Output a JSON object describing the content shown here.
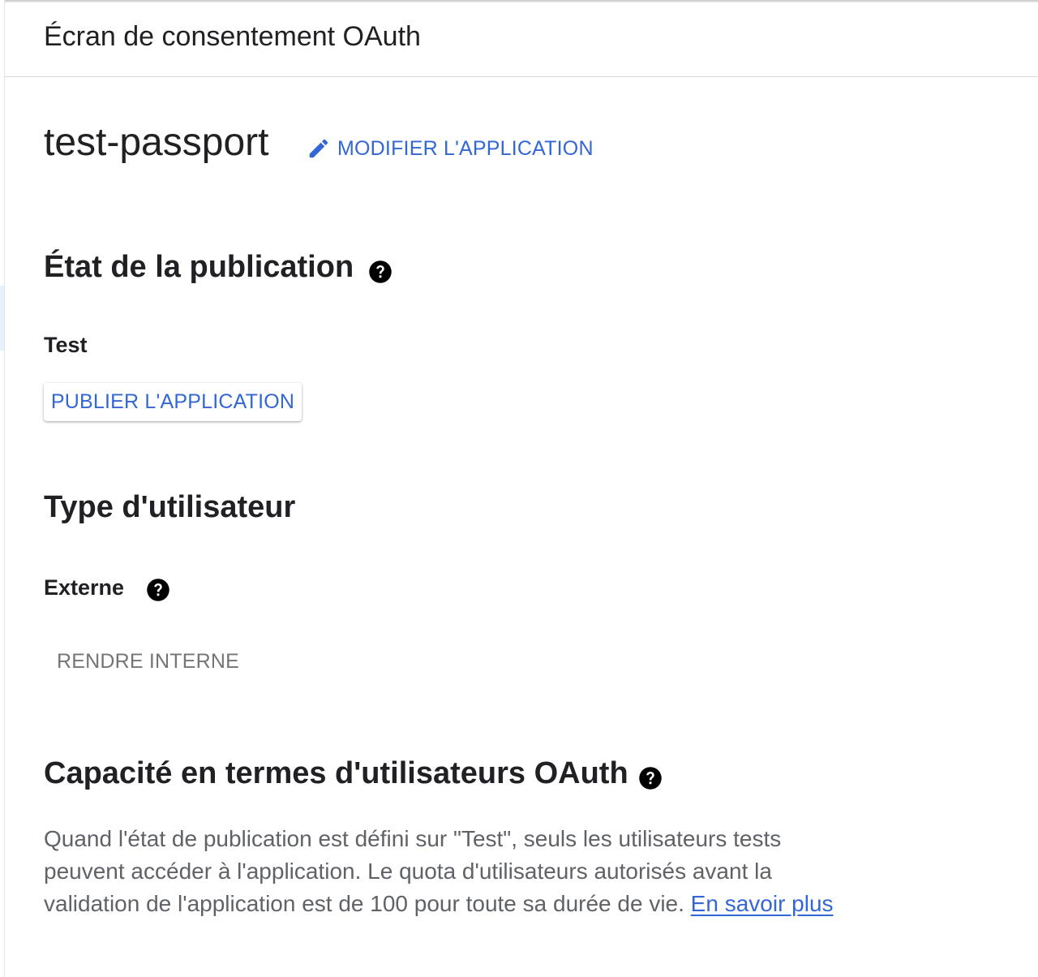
{
  "header": {
    "title": "Écran de consentement OAuth"
  },
  "app": {
    "name": "test-passport",
    "edit_label": "MODIFIER L'APPLICATION"
  },
  "publishing_status": {
    "heading": "État de la publication",
    "value": "Test",
    "publish_label": "PUBLIER L'APPLICATION"
  },
  "user_type": {
    "heading": "Type d'utilisateur",
    "value": "Externe",
    "make_internal_label": "RENDRE INTERNE"
  },
  "user_cap": {
    "heading": "Capacité en termes d'utilisateurs OAuth",
    "description": "Quand l'état de publication est défini sur \"Test\", seuls les utilisateurs tests peuvent accéder à l'application. Le quota d'utilisateurs autorisés avant la validation de l'application est de 100 pour toute sa durée de vie. ",
    "learn_more_label": "En savoir plus"
  },
  "icons": {
    "edit": "pencil-icon",
    "help": "help-circle-icon"
  },
  "colors": {
    "accent": "#3367d6",
    "text_primary": "#202124",
    "text_secondary": "#5f6368",
    "text_disabled": "#757575"
  }
}
